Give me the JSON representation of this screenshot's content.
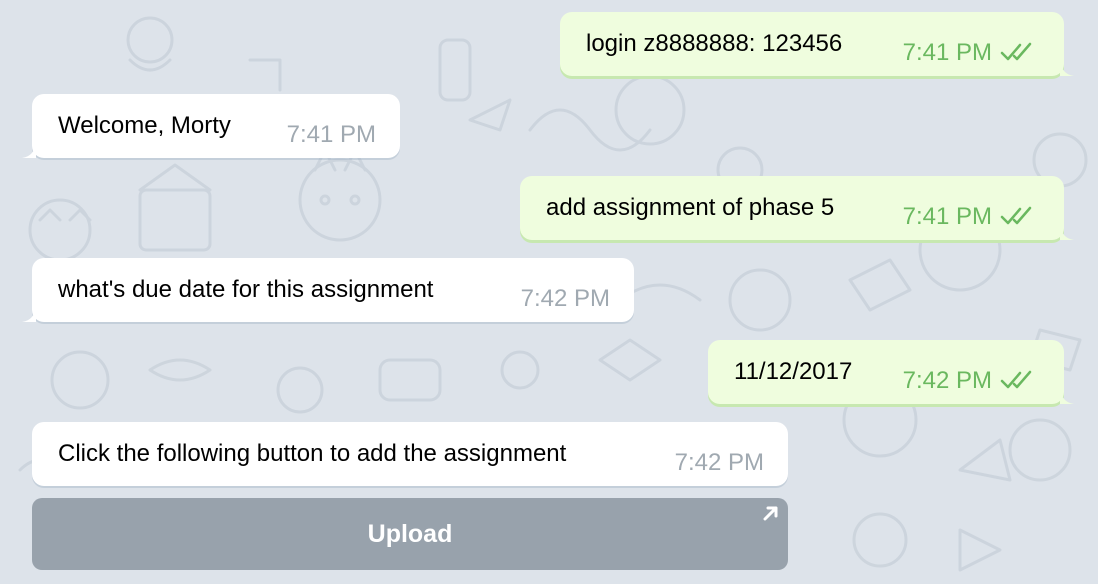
{
  "chat": {
    "messages": [
      {
        "direction": "out",
        "text": "login z8888888: 123456",
        "time": "7:41 PM"
      },
      {
        "direction": "in",
        "text": "Welcome, Morty",
        "time": "7:41 PM"
      },
      {
        "direction": "out",
        "text": "add assignment of phase 5",
        "time": "7:41 PM"
      },
      {
        "direction": "in",
        "text": "what's due date for this assignment",
        "time": "7:42 PM"
      },
      {
        "direction": "out",
        "text": "11/12/2017",
        "time": "7:42 PM"
      },
      {
        "direction": "in",
        "text": "Click the following button to add the assignment",
        "time": "7:42 PM"
      }
    ],
    "inline_button": {
      "label": "Upload",
      "icon": "arrow-up-right-icon"
    }
  },
  "colors": {
    "background": "#dde3ea",
    "incoming_bubble": "#ffffff",
    "outgoing_bubble": "#effdde",
    "outgoing_time": "#6ab85f",
    "incoming_time": "#a0a9b1",
    "button": "#98a2ac"
  },
  "icons": {
    "read_receipt": "double-check-icon"
  }
}
